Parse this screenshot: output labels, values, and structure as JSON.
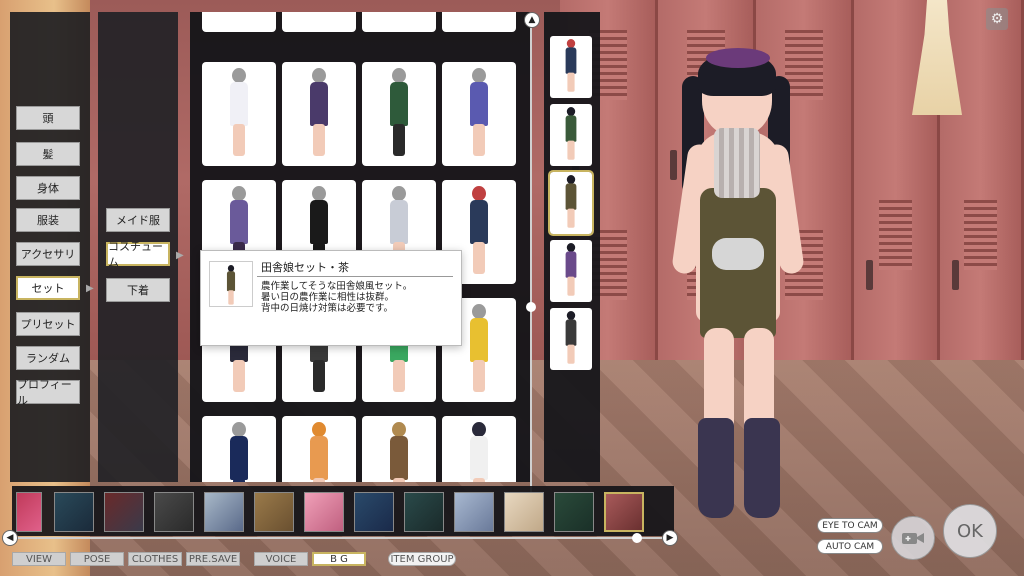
{
  "left_menu": {
    "items": [
      {
        "label": "頭"
      },
      {
        "label": "髪"
      },
      {
        "label": "身体"
      },
      {
        "label": "服装"
      },
      {
        "label": "アクセサリ"
      },
      {
        "label": "セット"
      },
      {
        "label": "プリセット"
      },
      {
        "label": "ランダム"
      },
      {
        "label": "プロフィール"
      }
    ],
    "selected": "セット"
  },
  "sub_menu": {
    "items": [
      {
        "label": "メイド服"
      },
      {
        "label": "コスチューム"
      },
      {
        "label": "下着"
      }
    ],
    "selected": "コスチューム"
  },
  "tooltip": {
    "title": "田舎娘セット・茶",
    "desc_line1": "農作業してそうな田舎娘風セット。",
    "desc_line2": "暑い日の農作業に相性は抜群。",
    "desc_line3": "背中の日焼け対策は必要です。"
  },
  "bottom_tabs": {
    "view": "VIEW",
    "pose": "POSE",
    "clothes": "CLOTHES",
    "pre_save": "PRE.SAVE",
    "voice": "VOICE",
    "bg": "B G",
    "item_group": "ITEM GROUP"
  },
  "camera": {
    "eye_to_cam": "EYE TO CAM",
    "auto_cam": "AUTO CAM"
  },
  "ok_label": "OK",
  "colors": {
    "panel": "#1e1e22",
    "selected_border": "#c8b460",
    "button_bg": "#d7d7d7"
  }
}
